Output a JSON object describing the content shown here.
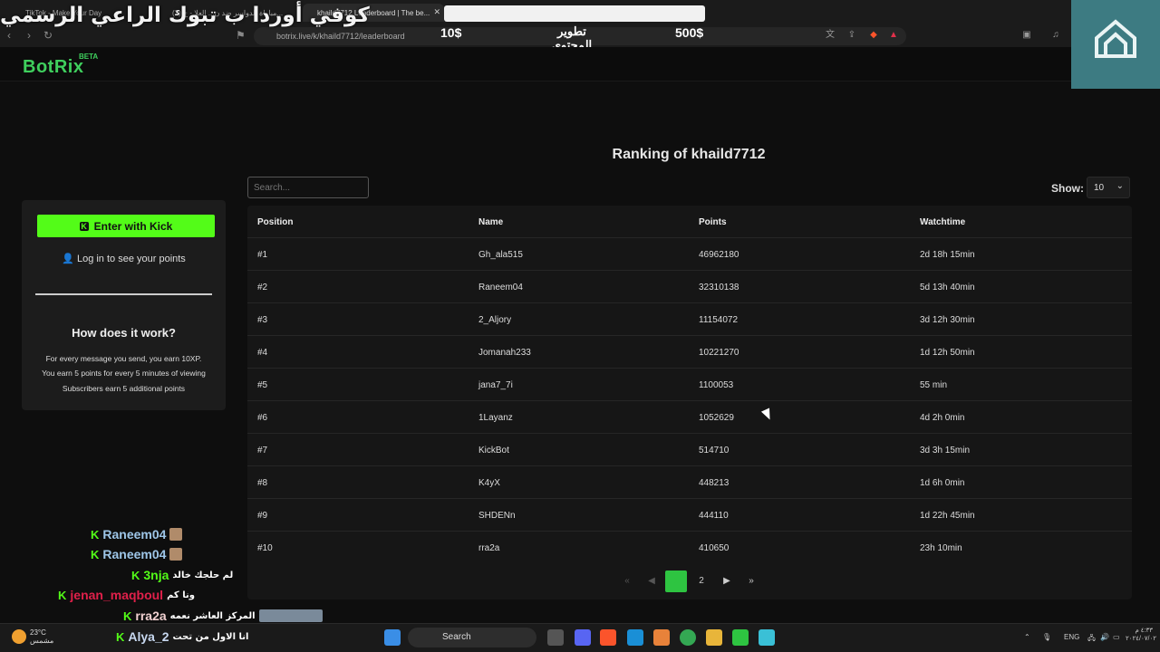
{
  "browser": {
    "tabs": [
      {
        "label": "TikTok - Make Your Day"
      },
      {
        "label": "(2) مباراة الدواسر ضد ن... العلا - ج..."
      },
      {
        "label": "khaild7712 Leaderboard | The be..."
      }
    ],
    "url": "botrix.live/k/khaild7712/leaderboard"
  },
  "overlay": {
    "title": "كوفي أوردا ب تبوك الراعي الرسمي",
    "price_left": "10$",
    "middle": "تطوير المحتوى والمايك",
    "price_right": "500$"
  },
  "site": {
    "brand": "BotRix",
    "beta": "BETA"
  },
  "sidebar": {
    "kick_button": "Enter with Kick",
    "login_text": "Log in to see your points",
    "how_title": "How does it work?",
    "how_lines": [
      "For every message you send, you earn 10XP.",
      "You earn 5 points for every 5 minutes of viewing",
      "Subscribers earn 5 additional points"
    ]
  },
  "leaderboard": {
    "title": "Ranking of khaild7712",
    "search_placeholder": "Search...",
    "show_label": "Show:",
    "show_value": "10",
    "columns": [
      "Position",
      "Name",
      "Points",
      "Watchtime"
    ],
    "rows": [
      {
        "position": "#1",
        "name": "Gh_ala515",
        "points": "46962180",
        "watchtime": "2d 18h 15min"
      },
      {
        "position": "#2",
        "name": "Raneem04",
        "points": "32310138",
        "watchtime": "5d 13h 40min"
      },
      {
        "position": "#3",
        "name": "2_Aljory",
        "points": "11154072",
        "watchtime": "3d 12h 30min"
      },
      {
        "position": "#4",
        "name": "Jomanah233",
        "points": "10221270",
        "watchtime": "1d 12h 50min"
      },
      {
        "position": "#5",
        "name": "jana7_7i",
        "points": "1100053",
        "watchtime": "55 min"
      },
      {
        "position": "#6",
        "name": "1Layanz",
        "points": "1052629",
        "watchtime": "4d 2h 0min"
      },
      {
        "position": "#7",
        "name": "KickBot",
        "points": "514710",
        "watchtime": "3d 3h 15min"
      },
      {
        "position": "#8",
        "name": "K4yX",
        "points": "448213",
        "watchtime": "1d 6h 0min"
      },
      {
        "position": "#9",
        "name": "SHDENn",
        "points": "444110",
        "watchtime": "1d 22h 45min"
      },
      {
        "position": "#10",
        "name": "rra2a",
        "points": "410650",
        "watchtime": "23h 10min"
      }
    ],
    "pagination": {
      "current": "1",
      "next_page": "2"
    }
  },
  "chat": [
    {
      "user": "Raneem04",
      "msg": "",
      "color": "#9ec6e8"
    },
    {
      "user": "Raneem04",
      "msg": "",
      "color": "#9ec6e8"
    },
    {
      "user": "3nja",
      "msg": "لم حلجك خالد",
      "color": "#53fc18"
    },
    {
      "user": "jenan_maqboul",
      "msg": "ونا كم",
      "color": "#e0204a"
    },
    {
      "user": "rra2a",
      "msg": "المركز العاشر نعمه",
      "color": "#f0d0d0"
    },
    {
      "user": "Alya_2",
      "msg": "انا الاول من تحت",
      "color": "#c8d8f0"
    }
  ],
  "taskbar": {
    "weather_temp": "23°C",
    "weather_desc": "مشمس",
    "search": "Search",
    "lang": "ENG",
    "time": "٤:٣٣ م",
    "date": "٢٠٢٤/٠٧/٠٢"
  }
}
